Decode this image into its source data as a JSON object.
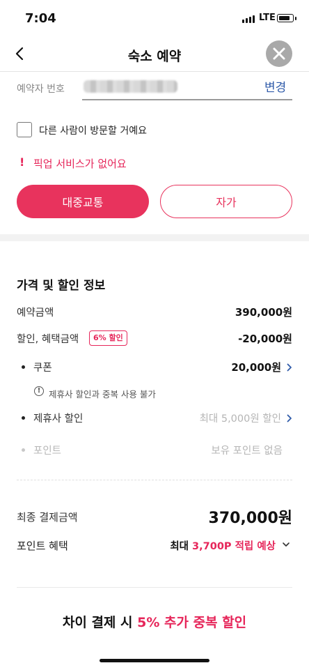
{
  "status": {
    "time": "7:04",
    "network": "LTE"
  },
  "header": {
    "title": "숙소 예약"
  },
  "booker": {
    "phone_label": "예약자 번호",
    "change_label": "변경"
  },
  "visitor": {
    "label": "다른 사람이 방문할 거예요"
  },
  "pickup": {
    "mark": "!",
    "notice": "픽업 서비스가 없어요"
  },
  "transport": {
    "transit_label": "대중교통",
    "car_label": "자가"
  },
  "price": {
    "section_title": "가격 및 할인 정보",
    "booking_amount_label": "예약금액",
    "booking_amount": "390,000원",
    "discount_label": "할인, 혜택금액",
    "discount_badge": "6% 할인",
    "discount_amount": "-20,000원",
    "coupon_label": "쿠폰",
    "coupon_amount": "20,000원",
    "coupon_note": "제휴사 할인과 중복 사용 불가",
    "partner_label": "제휴사 할인",
    "partner_value": "최대 5,000원 할인",
    "point_label": "포인트",
    "point_value": "보유 포인트 없음",
    "final_label": "최종 결제금액",
    "final_amount": "370,000원",
    "benefit_label": "포인트 혜택",
    "benefit_prefix": "최대 ",
    "benefit_points": "3,700P 적립 예상"
  },
  "promo": {
    "prefix": "차이 결제 시 ",
    "highlight": "5% 추가 중복 할인"
  },
  "colors": {
    "accent": "#e8335d",
    "link": "#2e5aa9"
  }
}
